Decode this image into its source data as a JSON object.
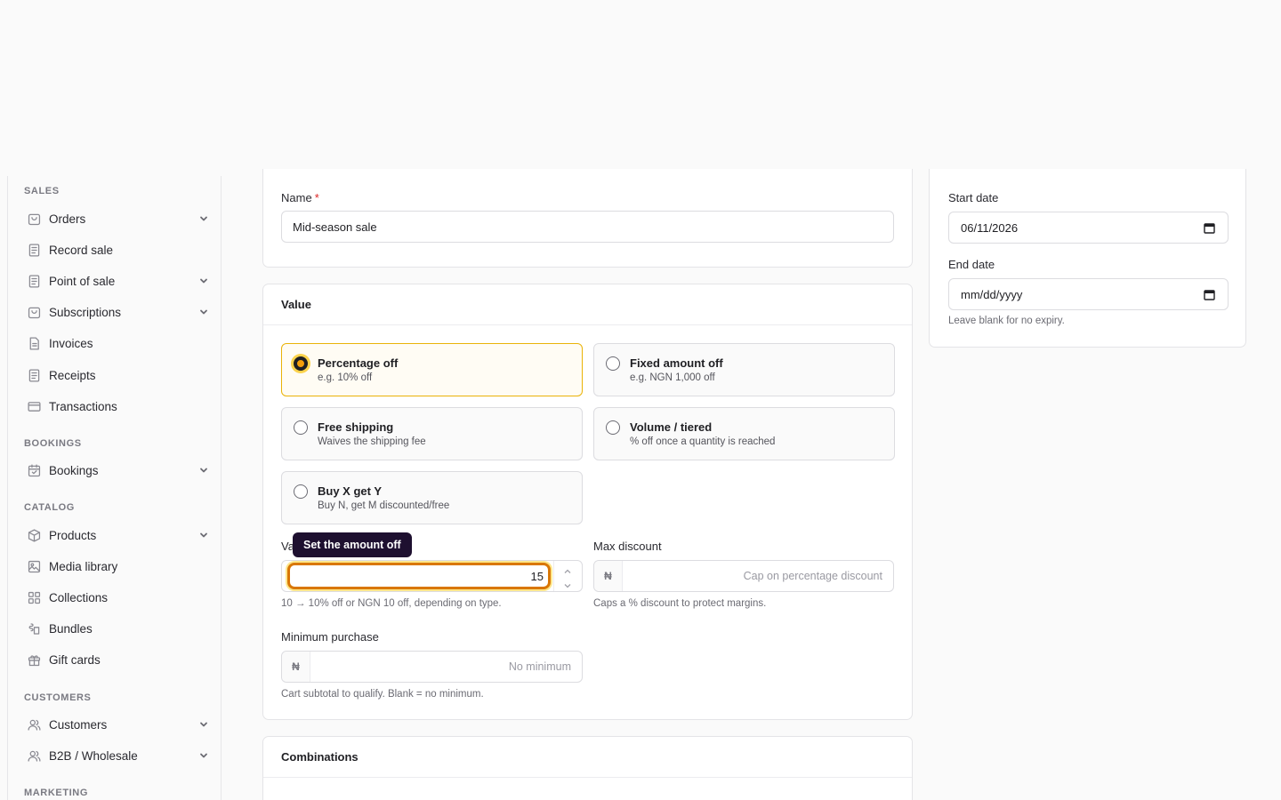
{
  "sidebar": {
    "sections": [
      {
        "label": "SALES"
      },
      {
        "label": "BOOKINGS"
      },
      {
        "label": "CATALOG"
      },
      {
        "label": "CUSTOMERS"
      },
      {
        "label": "MARKETING"
      }
    ],
    "items": [
      {
        "label": "Orders",
        "icon": "bag-icon",
        "expandable": true
      },
      {
        "label": "Record sale",
        "icon": "receipt-icon",
        "expandable": false
      },
      {
        "label": "Point of sale",
        "icon": "receipt-icon",
        "expandable": true
      },
      {
        "label": "Subscriptions",
        "icon": "bag-icon",
        "expandable": true
      },
      {
        "label": "Invoices",
        "icon": "document-icon",
        "expandable": false
      },
      {
        "label": "Receipts",
        "icon": "receipt-icon",
        "expandable": false
      },
      {
        "label": "Transactions",
        "icon": "credit-card-icon",
        "expandable": false
      },
      {
        "label": "Bookings",
        "icon": "calendar-icon",
        "expandable": true
      },
      {
        "label": "Products",
        "icon": "box-icon",
        "expandable": true
      },
      {
        "label": "Media library",
        "icon": "image-icon",
        "expandable": false
      },
      {
        "label": "Collections",
        "icon": "grid-icon",
        "expandable": false
      },
      {
        "label": "Bundles",
        "icon": "bundle-icon",
        "expandable": false
      },
      {
        "label": "Gift cards",
        "icon": "gift-icon",
        "expandable": false
      },
      {
        "label": "Customers",
        "icon": "users-icon",
        "expandable": true
      },
      {
        "label": "B2B / Wholesale",
        "icon": "users-icon",
        "expandable": true
      }
    ]
  },
  "details": {
    "name_label": "Name",
    "name_required": "*",
    "name_value": "Mid-season sale"
  },
  "value_card": {
    "title": "Value",
    "options": [
      {
        "title": "Percentage off",
        "subtitle": "e.g. 10% off",
        "selected": true
      },
      {
        "title": "Fixed amount off",
        "subtitle": "e.g. NGN 1,000 off",
        "selected": false
      },
      {
        "title": "Free shipping",
        "subtitle": "Waives the shipping fee",
        "selected": false
      },
      {
        "title": "Volume / tiered",
        "subtitle": "% off once a quantity is reached",
        "selected": false
      },
      {
        "title": "Buy X get Y",
        "subtitle": "Buy N, get M discounted/free",
        "selected": false
      }
    ],
    "value_label_visible": "Va",
    "value": "15",
    "value_help": "10 → 10% off or NGN 10 off, depending on type.",
    "tooltip": "Set the amount off",
    "max_discount_label": "Max discount",
    "max_discount_prefix": "₦",
    "max_discount_placeholder": "Cap on percentage discount",
    "max_discount_help": "Caps a % discount to protect margins.",
    "min_purchase_label": "Minimum purchase",
    "min_purchase_prefix": "₦",
    "min_purchase_placeholder": "No minimum",
    "min_purchase_help": "Cart subtotal to qualify. Blank = no minimum."
  },
  "combinations": {
    "title": "Combinations"
  },
  "schedule": {
    "start_label": "Start date",
    "start_value": "06/11/2026",
    "end_label": "End date",
    "end_value": "mm/dd/yyyy",
    "end_help": "Leave blank for no expiry."
  },
  "colors": {
    "accent": "#d97706",
    "selected_border": "#eab308",
    "tooltip_bg": "#1e1030",
    "required": "#dc2626"
  }
}
